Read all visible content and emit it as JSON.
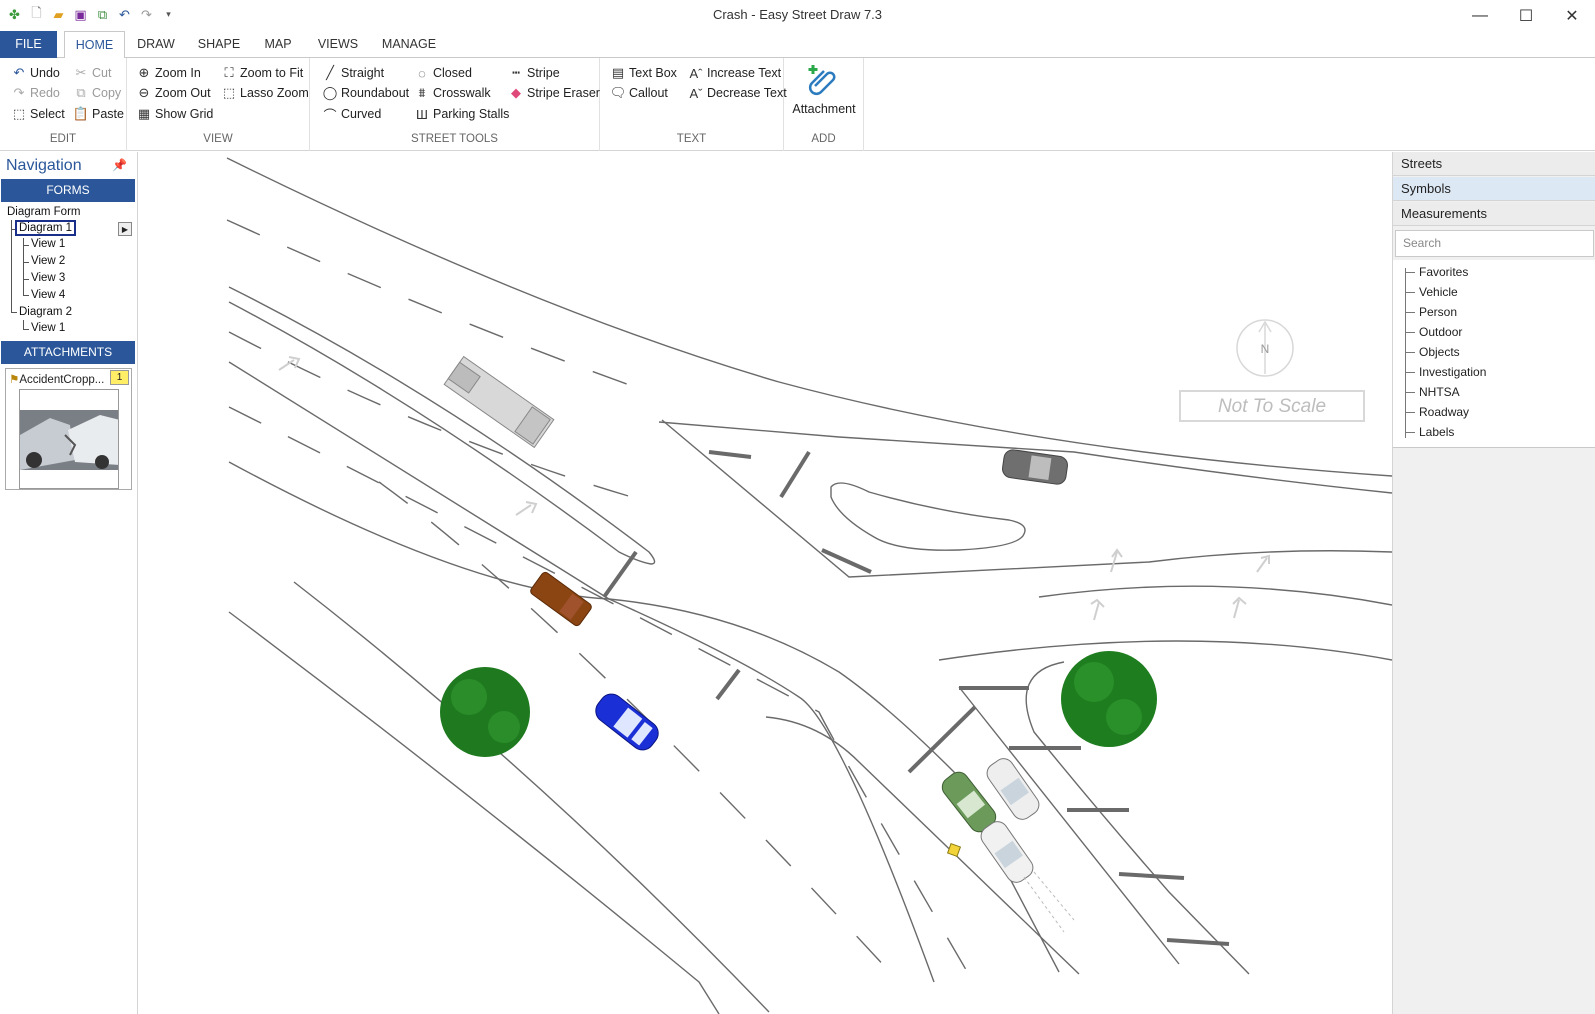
{
  "window": {
    "title": "Crash - Easy Street Draw 7.3"
  },
  "ribbon_tabs": [
    "FILE",
    "HOME",
    "DRAW",
    "SHAPE",
    "MAP",
    "VIEWS",
    "MANAGE"
  ],
  "edit": {
    "label": "EDIT",
    "undo": "Undo",
    "redo": "Redo",
    "select": "Select",
    "cut": "Cut",
    "copy": "Copy",
    "paste": "Paste"
  },
  "view": {
    "label": "VIEW",
    "zoom_in": "Zoom In",
    "zoom_out": "Zoom Out",
    "show_grid": "Show Grid",
    "zoom_to_fit": "Zoom to Fit",
    "lasso_zoom": "Lasso Zoom"
  },
  "street_tools": {
    "label": "STREET TOOLS",
    "straight": "Straight",
    "roundabout": "Roundabout",
    "curved": "Curved",
    "closed": "Closed",
    "crosswalk": "Crosswalk",
    "parking_stalls": "Parking Stalls",
    "stripe": "Stripe",
    "stripe_eraser": "Stripe Eraser"
  },
  "text": {
    "label": "TEXT",
    "text_box": "Text Box",
    "callout": "Callout",
    "increase_text": "Increase Text",
    "decrease_text": "Decrease Text"
  },
  "add": {
    "label": "ADD",
    "attachment": "Attachment"
  },
  "navigation": {
    "title": "Navigation",
    "forms_header": "FORMS",
    "tree": {
      "root": "Diagram Form",
      "diagram1": "Diagram 1",
      "views1": [
        "View 1",
        "View 2",
        "View 3",
        "View 4"
      ],
      "diagram2": "Diagram 2",
      "views2": [
        "View 1"
      ]
    },
    "attachments_header": "ATTACHMENTS",
    "attachment": {
      "name": "AccidentCropp...",
      "count": "1"
    }
  },
  "canvas": {
    "north_label": "N",
    "scale_label": "Not To Scale"
  },
  "right_panel": {
    "tabs": [
      "Streets",
      "Symbols",
      "Measurements"
    ],
    "search_placeholder": "Search",
    "categories": [
      "Favorites",
      "Vehicle",
      "Person",
      "Outdoor",
      "Objects",
      "Investigation",
      "NHTSA",
      "Roadway",
      "Labels"
    ]
  },
  "colors": {
    "accent": "#2b579a",
    "tree_green": "#1f7a1f",
    "blue_car": "#1a2fd6",
    "brown_truck": "#8b4513",
    "green_car": "#6b9a5b"
  }
}
